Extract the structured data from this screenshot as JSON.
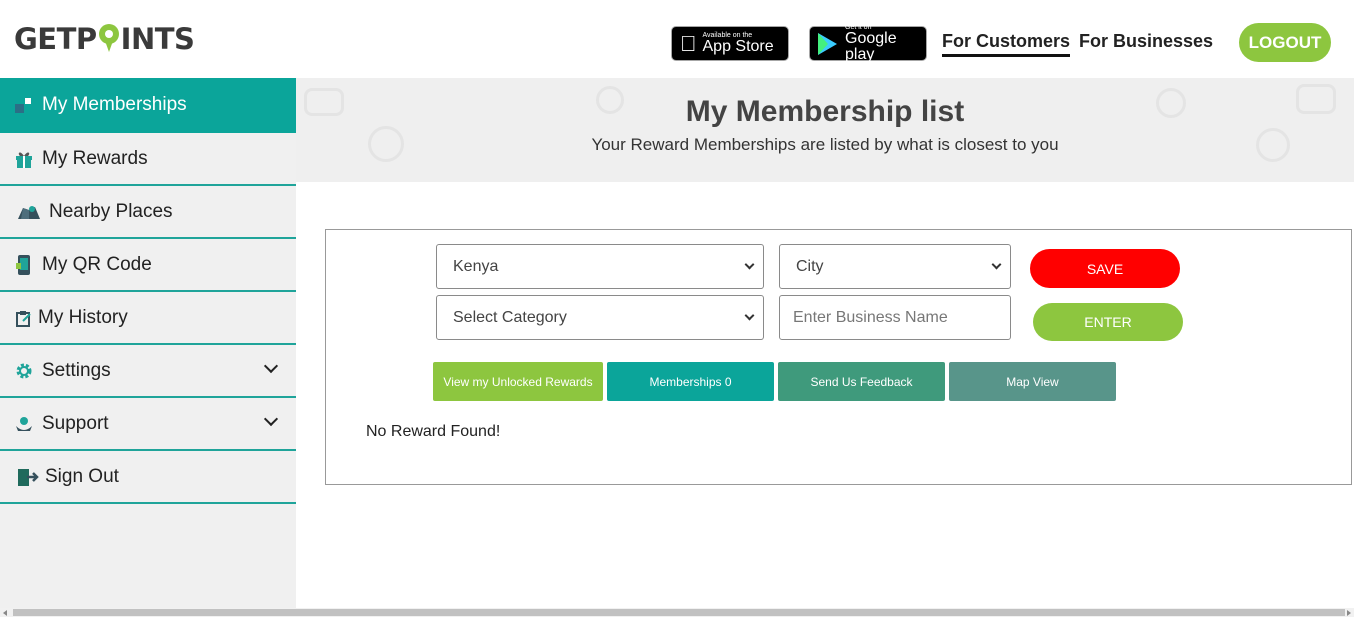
{
  "header": {
    "logo_left": "GETP",
    "logo_right": "INTS",
    "appstore": {
      "small": "Available on the",
      "big": "App Store"
    },
    "googleplay": {
      "small": "Get it on",
      "big": "Google play"
    },
    "nav": {
      "customers": "For Customers",
      "businesses": "For Businesses"
    },
    "logout": "LOGOUT"
  },
  "sidebar": {
    "items": [
      {
        "label": "My Memberships",
        "icon": "memberships-icon",
        "active": true
      },
      {
        "label": "My Rewards",
        "icon": "gift-icon"
      },
      {
        "label": "Nearby Places",
        "icon": "map-icon"
      },
      {
        "label": "My QR Code",
        "icon": "phone-qr-icon"
      },
      {
        "label": "My History",
        "icon": "clipboard-icon"
      },
      {
        "label": "Settings",
        "icon": "gear-icon",
        "expandable": true
      },
      {
        "label": "Support",
        "icon": "support-icon",
        "expandable": true
      },
      {
        "label": "Sign Out",
        "icon": "sign-out-icon"
      }
    ]
  },
  "banner": {
    "title": "My Membership list",
    "subtitle": "Your Reward Memberships are listed by what is closest to you"
  },
  "filters": {
    "country": "Kenya",
    "city": "City",
    "category": "Select Category",
    "business_placeholder": "Enter Business Name",
    "save": "SAVE",
    "enter": "ENTER"
  },
  "tabs": {
    "unlocked": "View my Unlocked Rewards",
    "memberships": "Memberships 0",
    "feedback": "Send Us Feedback",
    "map": "Map View"
  },
  "colors": {
    "teal": "#0ba59a",
    "green": "#8dc63f",
    "red": "#ff0000",
    "feedback": "#3f9a7c",
    "map": "#58958a"
  },
  "empty_message": "No Reward Found!"
}
